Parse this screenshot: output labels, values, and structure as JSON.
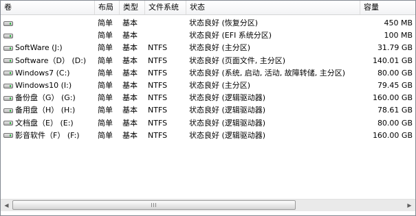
{
  "columns": {
    "volume": "卷",
    "layout": "布局",
    "type": "类型",
    "fs": "文件系统",
    "status": "状态",
    "capacity": "容量"
  },
  "rows": [
    {
      "volume": "",
      "layout": "简单",
      "type": "基本",
      "fs": "",
      "status": "状态良好 (恢复分区)",
      "capacity": "450 MB"
    },
    {
      "volume": "",
      "layout": "简单",
      "type": "基本",
      "fs": "",
      "status": "状态良好 (EFI 系统分区)",
      "capacity": "100 MB"
    },
    {
      "volume": "SoftWare (J:)",
      "layout": "简单",
      "type": "基本",
      "fs": "NTFS",
      "status": "状态良好 (主分区)",
      "capacity": "31.79 GB"
    },
    {
      "volume": "Software（D） (D:)",
      "layout": "简单",
      "type": "基本",
      "fs": "NTFS",
      "status": "状态良好 (页面文件, 主分区)",
      "capacity": "140.01 GB"
    },
    {
      "volume": "Windows7 (C:)",
      "layout": "简单",
      "type": "基本",
      "fs": "NTFS",
      "status": "状态良好 (系统, 启动, 活动, 故障转储, 主分区)",
      "capacity": "80.00 GB"
    },
    {
      "volume": "Windows10 (I:)",
      "layout": "简单",
      "type": "基本",
      "fs": "NTFS",
      "status": "状态良好 (主分区)",
      "capacity": "79.45 GB"
    },
    {
      "volume": "备份盘（G） (G:)",
      "layout": "简单",
      "type": "基本",
      "fs": "NTFS",
      "status": "状态良好 (逻辑驱动器)",
      "capacity": "160.00 GB"
    },
    {
      "volume": "备用盘（H） (H:)",
      "layout": "简单",
      "type": "基本",
      "fs": "NTFS",
      "status": "状态良好 (逻辑驱动器)",
      "capacity": "78.61 GB"
    },
    {
      "volume": "文档盘（E） (E:)",
      "layout": "简单",
      "type": "基本",
      "fs": "NTFS",
      "status": "状态良好 (逻辑驱动器)",
      "capacity": "80.00 GB"
    },
    {
      "volume": "影音软件（F） (F:)",
      "layout": "简单",
      "type": "基本",
      "fs": "NTFS",
      "status": "状态良好 (逻辑驱动器)",
      "capacity": "160.00 GB"
    }
  ],
  "icons": {
    "volume_icon": "disk-drive-icon",
    "scroll_left": "scroll-left-arrow-icon",
    "scroll_right": "scroll-right-arrow-icon"
  }
}
